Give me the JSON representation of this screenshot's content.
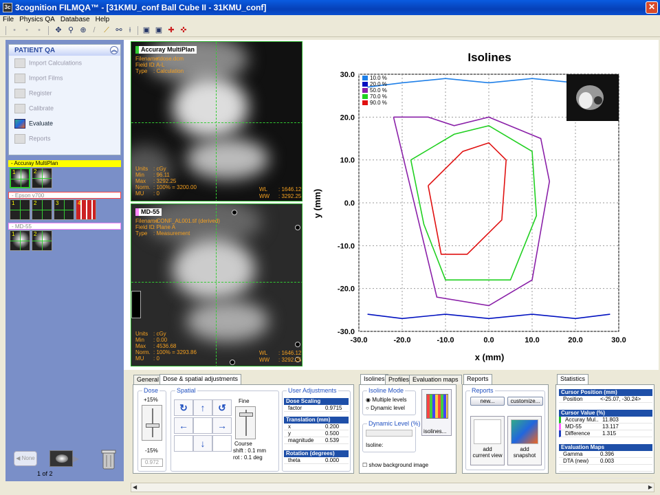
{
  "window": {
    "title": "3cognition FILMQA™ - [31KMU_conf Ball Cube II - 31KMU_conf]",
    "close_label": "✕"
  },
  "menu": [
    "File",
    "Physics QA",
    "Database",
    "Help"
  ],
  "patient_qa": {
    "header": "PATIENT QA",
    "items": [
      "Import Calculations",
      "Import Films",
      "Register",
      "Calibrate",
      "Evaluate",
      "Reports"
    ]
  },
  "groups": [
    {
      "label": "- Accuray MultiPlan",
      "color": "#ffff00"
    },
    {
      "label": "- Epson v700",
      "color": "#ff4040"
    },
    {
      "label": "- MD-55",
      "color": "#ff80ff"
    }
  ],
  "nav": {
    "none_label": "None",
    "count": "1 of 2"
  },
  "image_top": {
    "label": "Accuray MultiPlan",
    "meta": [
      [
        "Filename",
        ": rtdose.dcm"
      ],
      [
        "Field ID",
        ": A-L"
      ],
      [
        "Type",
        ": Calculation"
      ]
    ],
    "stats": [
      [
        "Units",
        ": cGy"
      ],
      [
        "Min",
        ": 96.11"
      ],
      [
        "Max",
        ": 3292.25"
      ],
      [
        "Norm.",
        ": 100% = 3200.00"
      ],
      [
        "MU",
        ": 0"
      ]
    ],
    "wl": [
      [
        "WL",
        ": 1646.12"
      ],
      [
        "WW",
        ": 3292.25"
      ]
    ]
  },
  "image_bottom": {
    "label": "MD-55",
    "meta": [
      [
        "Filename",
        ": CONF_AL001.tif (derived)"
      ],
      [
        "Field ID",
        ": Plane A"
      ],
      [
        "Type",
        ": Measurement"
      ]
    ],
    "stats": [
      [
        "Units",
        ": cGy"
      ],
      [
        "Min",
        ": 0.00"
      ],
      [
        "Max",
        ": 4536.68"
      ],
      [
        "Norm.",
        ": 100% = 3293.86"
      ],
      [
        "MU",
        ": 0"
      ]
    ],
    "wl": [
      [
        "WL",
        ": 1646.12"
      ],
      [
        "WW",
        ": 3292.25"
      ]
    ]
  },
  "chart_data": {
    "type": "line",
    "title": "Isolines",
    "xlabel": "x (mm)",
    "ylabel": "y (mm)",
    "xlim": [
      -30,
      30
    ],
    "ylim": [
      -30,
      30
    ],
    "xticks": [
      "-30.0",
      "-20.0",
      "-10.0",
      "0.0",
      "10.0",
      "20.0",
      "30.0"
    ],
    "yticks": [
      "30.0",
      "20.0",
      "10.0",
      "0.0",
      "-10.0",
      "-20.0",
      "-30.0"
    ],
    "grid": true,
    "legend_position": "top-left",
    "series": [
      {
        "name": "10.0 %",
        "color": "#1e7fe8",
        "x": [
          -28,
          -20,
          -10,
          0,
          10,
          20,
          28
        ],
        "y": [
          27,
          28,
          29,
          28,
          29,
          28,
          27
        ]
      },
      {
        "name": "20.0 %",
        "color": "#0010c0",
        "x": [
          -28,
          -20,
          -10,
          0,
          10,
          20,
          28
        ],
        "y": [
          -26,
          -27,
          -26,
          -27,
          -26,
          -27,
          -26
        ]
      },
      {
        "name": "50.0 %",
        "color": "#8a20a8",
        "x": [
          -22,
          -14,
          -8,
          0,
          12,
          14,
          10,
          0,
          -12,
          -22
        ],
        "y": [
          20,
          20,
          18,
          20,
          15,
          5,
          -18,
          -24,
          -22,
          20
        ]
      },
      {
        "name": "70.0 %",
        "color": "#20d020",
        "x": [
          -18,
          -8,
          0,
          10,
          11,
          5,
          -10,
          -15,
          -18
        ],
        "y": [
          10,
          16,
          18,
          12,
          -3,
          -18,
          -18,
          -5,
          10
        ]
      },
      {
        "name": "90.0 %",
        "color": "#e01010",
        "x": [
          -14,
          -6,
          0,
          4,
          3,
          -5,
          -11,
          -14
        ],
        "y": [
          4,
          12,
          14,
          10,
          -4,
          -12,
          -12,
          4
        ]
      }
    ]
  },
  "tabs_left": [
    "General",
    "Dose & spatial adjustments"
  ],
  "dose": {
    "label": "Dose",
    "top": "+15%",
    "bottom": "-15%",
    "value": "0.972"
  },
  "spatial": {
    "label": "Spatial",
    "fine": "Fine",
    "course": "Course",
    "shift": "shift : 0.1 mm",
    "rot": "rot : 0.1 deg",
    "arrows": [
      "↻",
      "↑",
      "↺",
      "←",
      "→",
      "↓"
    ]
  },
  "user_adj": {
    "label": "User Adjustments",
    "dose_scaling": {
      "title": "Dose Scaling",
      "rows": [
        [
          "factor",
          "0.9715"
        ]
      ]
    },
    "translation": {
      "title": "Translation (mm)",
      "rows": [
        [
          "x",
          "0.200"
        ],
        [
          "y",
          "0.500"
        ],
        [
          "magnitude",
          "0.539"
        ]
      ]
    },
    "rotation": {
      "title": "Rotation (degrees)",
      "rows": [
        [
          "theta",
          "0.000"
        ]
      ]
    }
  },
  "tabs_mid": [
    "Isolines",
    "Profiles",
    "Evaluation maps"
  ],
  "isoline_mode": {
    "label": "Isoline Mode",
    "opt1": "Multiple levels",
    "opt2": "Dynamic level",
    "dyn_label": "Dynamic Level (%)",
    "isoline": "Isoline:",
    "isolines_btn": "isolines...",
    "show_bg": "show background image"
  },
  "reports": {
    "tab": "Reports",
    "label": "Reports",
    "new": "new...",
    "customize": "customize...",
    "add_current": "add\ncurrent view",
    "add_snapshot": "add\nsnapshot"
  },
  "stats": {
    "tab": "Statistics",
    "cursor_pos": {
      "title": "Cursor Position (mm)",
      "rows": [
        [
          "Position",
          "<-25.07, -30.24>"
        ]
      ]
    },
    "cursor_val": {
      "title": "Cursor Value (%)",
      "rows": [
        [
          "Accuray Mul..",
          "11.803",
          "#20c020"
        ],
        [
          "MD-55",
          "13.117",
          "#ff60ff"
        ],
        [
          "Difference",
          "1.315",
          "#2040c0"
        ]
      ]
    },
    "eval": {
      "title": "Evaluation Maps",
      "rows": [
        [
          "Gamma",
          "0.396"
        ],
        [
          "DTA (new)",
          "0.003"
        ]
      ]
    }
  }
}
